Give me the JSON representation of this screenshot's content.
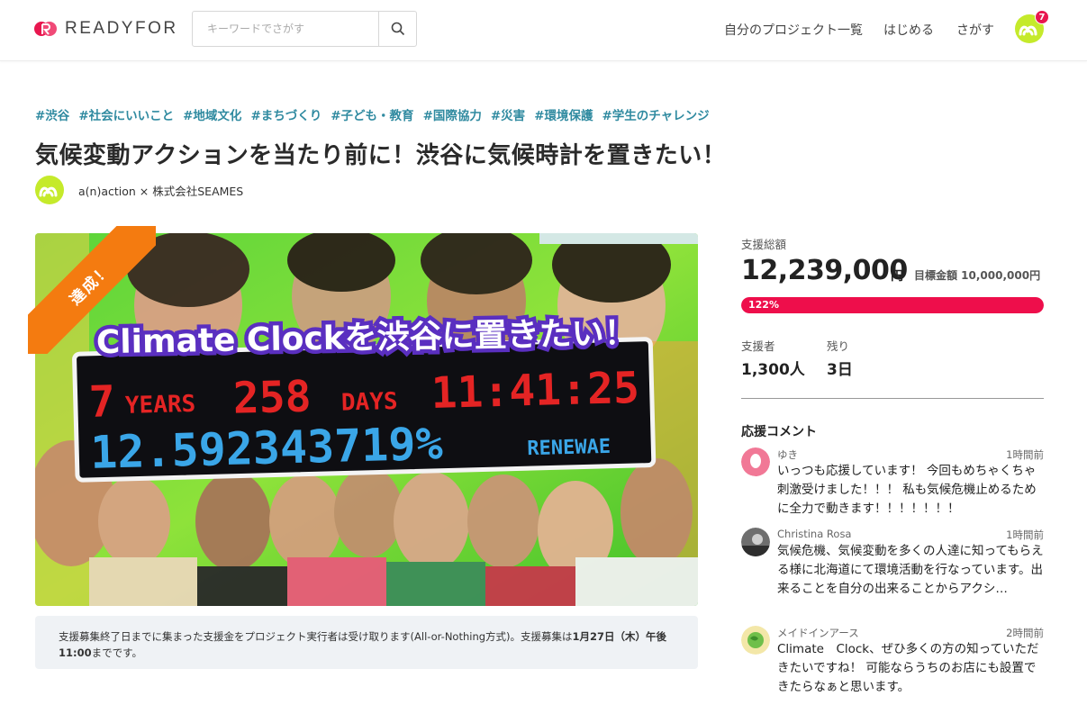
{
  "brand": {
    "name": "READYFOR",
    "color": "#e8174f"
  },
  "search": {
    "placeholder": "キーワードでさがす",
    "icon": "search-icon"
  },
  "nav": {
    "my_projects": "自分のプロジェクト一覧",
    "start": "はじめる",
    "browse": "さがす"
  },
  "user": {
    "notification_count": "7",
    "avatar_color": "#c5ea2b"
  },
  "project": {
    "tags": [
      "#渋谷",
      "#社会にいいこと",
      "#地域文化",
      "#まちづくり",
      "#子ども・教育",
      "#国際協力",
      "#災害",
      "#環境保護",
      "#学生のチャレンジ"
    ],
    "title": "気候変動アクションを当たり前に！渋谷に気候時計を置きたい！",
    "owner": "a(n)action × 株式会社SEAMES",
    "ribbon": "達成！",
    "hero": {
      "headline": "Climate Clockを渋谷に置きたい！",
      "clock_years": "7",
      "clock_years_unit": "YEARS",
      "clock_days": "258",
      "clock_days_unit": "DAYS",
      "clock_time": "11:41:25",
      "clock_percent": "12.592343719%",
      "clock_label": "RENEWAE"
    },
    "notice_prefix": "支援募集終了日までに集まった支援金をプロジェクト実行者は受け取ります(All-or-Nothing方式)。支援募集は",
    "notice_date": "1月27日（木）午後11:00",
    "notice_suffix": "までです。"
  },
  "stats": {
    "total_label": "支援総額",
    "total": "12,239,000",
    "yen": "円",
    "goal": "目標金額 10,000,000円",
    "progress_text": "122%",
    "progress_fraction": 1.22,
    "supporters_label": "支援者",
    "supporters": "1,300人",
    "remaining_label": "残り",
    "remaining": "3日"
  },
  "comments_title": "応援コメント",
  "comments": [
    {
      "name": "ゆき",
      "time": "1時間前",
      "text": "いっつも応援しています！ 今回もめちゃくちゃ刺激受けました！！！ 私も気候危機止めるために全力で動きます！！！！！！！"
    },
    {
      "name": "Christina Rosa",
      "time": "1時間前",
      "text": "気候危機、気候変動を多くの人達に知ってもらえる様に北海道にて環境活動を行なっています。出来ることを自分の出来ることからアクシ…"
    },
    {
      "name": "メイドインアース",
      "time": "2時間前",
      "text": "Climate　Clock、ぜひ多くの方の知っていただきたいですね！ 可能ならうちのお店にも設置できたらなぁと思います。"
    }
  ]
}
